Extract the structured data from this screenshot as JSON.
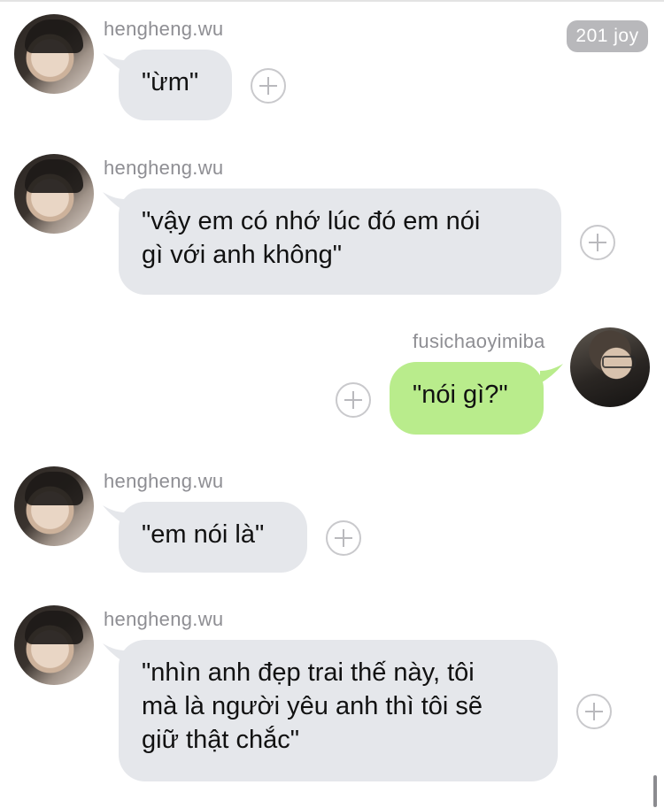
{
  "badge": {
    "label": "201 joy"
  },
  "messages": [
    {
      "sender": "hengheng.wu",
      "text": "\"ừm\""
    },
    {
      "sender": "hengheng.wu",
      "text": "\"vậy em có nhớ lúc đó em nói\ngì với anh không\""
    },
    {
      "sender": "fusichaoyimiba",
      "text": "\"nói gì?\""
    },
    {
      "sender": "hengheng.wu",
      "text": "\"em nói là\""
    },
    {
      "sender": "hengheng.wu",
      "text": "\"nhìn anh đẹp trai thế này, tôi\nmà là người yêu anh thì tôi sẽ\ngiữ thật chắc\""
    }
  ],
  "colors": {
    "incoming_bubble": "#e5e7eb",
    "outgoing_bubble": "#b9ec8c",
    "sender_name": "#8e8e93",
    "badge": "#b8b8bb"
  },
  "icons": {
    "add": "plus-circle-icon"
  }
}
